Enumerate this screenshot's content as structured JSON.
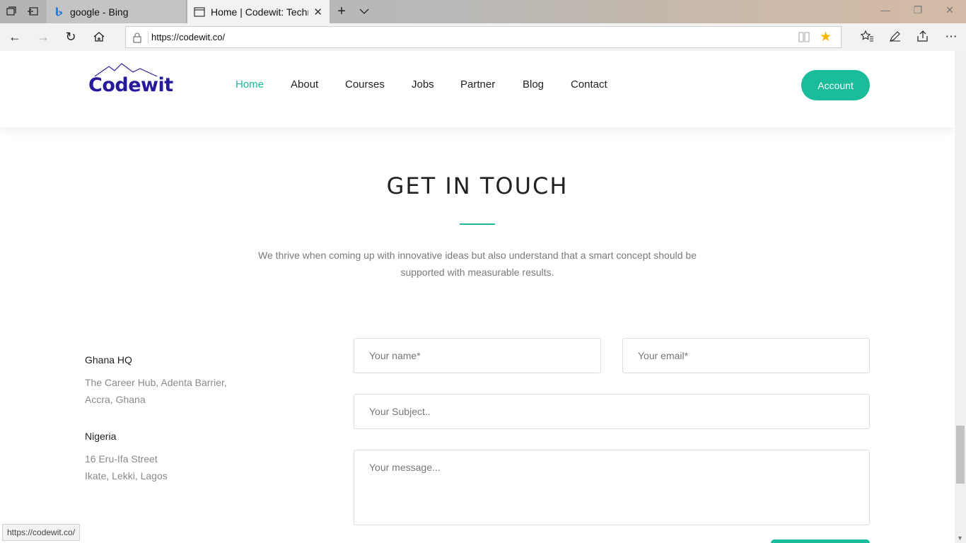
{
  "browser": {
    "tabs": [
      {
        "title": "google - Bing",
        "favicon": "bing-icon"
      },
      {
        "title": "Home | Codewit: Technology",
        "favicon": "page-icon",
        "active": true
      }
    ],
    "url": "https://codewit.co/",
    "status_url": "https://codewit.co/"
  },
  "site": {
    "logo_text": "Codewit",
    "nav": [
      {
        "label": "Home",
        "active": true
      },
      {
        "label": "About"
      },
      {
        "label": "Courses"
      },
      {
        "label": "Jobs"
      },
      {
        "label": "Partner"
      },
      {
        "label": "Blog"
      },
      {
        "label": "Contact"
      }
    ],
    "account_label": "Account",
    "accent_color": "#1bbc9b",
    "logo_color": "#241a9a"
  },
  "contact": {
    "title": "GET IN TOUCH",
    "description_line1": "We thrive when coming up with innovative ideas but also understand that a smart concept should be",
    "description_line2": "supported with measurable results.",
    "offices": [
      {
        "name": "Ghana HQ",
        "line1": "The Career Hub, Adenta Barrier,",
        "line2": "Accra, Ghana"
      },
      {
        "name": "Nigeria",
        "line1": "16 Eru-Ifa Street",
        "line2": "Ikate, Lekki, Lagos"
      }
    ],
    "form": {
      "name_placeholder": "Your name*",
      "email_placeholder": "Your email*",
      "subject_placeholder": "Your Subject..",
      "message_placeholder": "Your message..."
    }
  }
}
